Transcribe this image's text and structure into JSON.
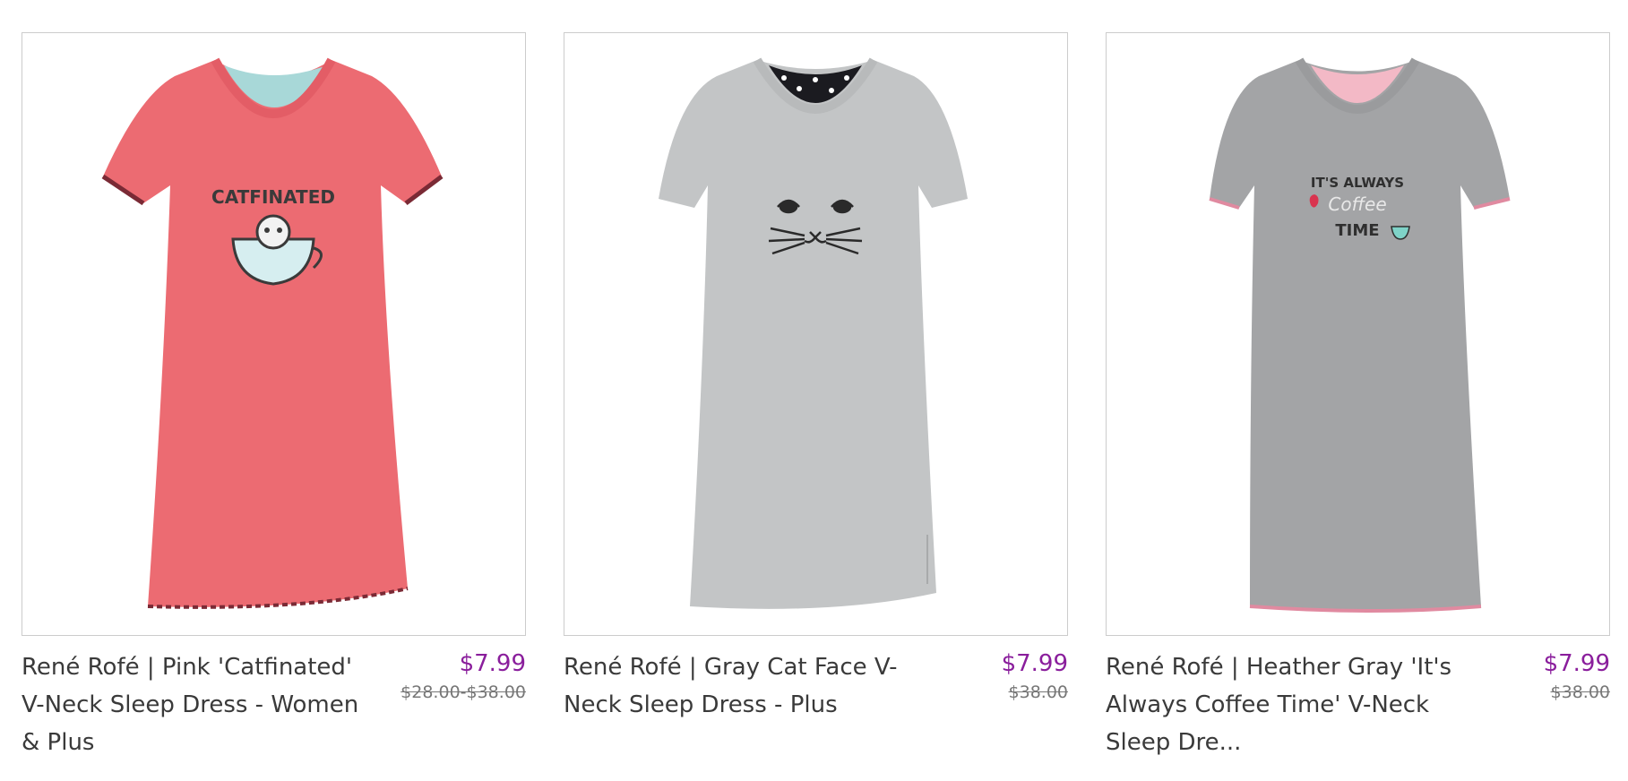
{
  "products": [
    {
      "title": "René Rofé | Pink 'Catfinated' V-Neck Sleep Dress - Women & Plus",
      "price": "$7.99",
      "original_price": "$28.00-$38.00",
      "graphic_text": "CATFINATED",
      "colors": {
        "dress": "#ec6b72",
        "trim": "#7a2a35",
        "lining": "#a8d8d8"
      }
    },
    {
      "title": "René Rofé | Gray Cat Face V-Neck Sleep Dress - Plus",
      "price": "$7.99",
      "original_price": "$38.00",
      "graphic_text": "",
      "colors": {
        "dress": "#c3c5c6",
        "trim": "#b8babb",
        "lining": "#1b1b20"
      }
    },
    {
      "title": "René Rofé | Heather Gray 'It's Always Coffee Time' V-Neck Sleep Dre...",
      "price": "$7.99",
      "original_price": "$38.00",
      "graphic_text_lines": [
        "IT'S ALWAYS",
        "Coffee",
        "TIME"
      ],
      "colors": {
        "dress": "#a3a4a6",
        "trim": "#e08aa0",
        "lining": "#f3b9c6"
      }
    }
  ]
}
